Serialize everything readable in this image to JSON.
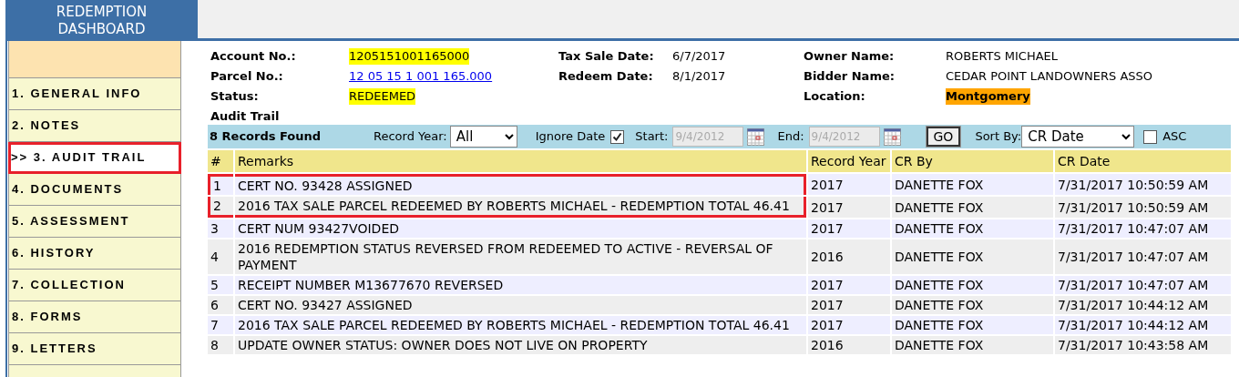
{
  "header": {
    "title": "REDEMPTION DASHBOARD"
  },
  "sidebar": {
    "items": [
      {
        "label": "1. GENERAL INFO",
        "selected": false,
        "highlighted": false
      },
      {
        "label": "2. NOTES",
        "selected": false,
        "highlighted": false
      },
      {
        "label": ">> 3. AUDIT TRAIL",
        "selected": true,
        "highlighted": true
      },
      {
        "label": "4. DOCUMENTS",
        "selected": false,
        "highlighted": false
      },
      {
        "label": "5. ASSESSMENT",
        "selected": false,
        "highlighted": false
      },
      {
        "label": "6. HISTORY",
        "selected": false,
        "highlighted": false
      },
      {
        "label": "7. COLLECTION",
        "selected": false,
        "highlighted": false
      },
      {
        "label": "8. FORMS",
        "selected": false,
        "highlighted": false
      },
      {
        "label": "9. LETTERS",
        "selected": false,
        "highlighted": false
      }
    ]
  },
  "info": [
    {
      "label": "Account No.:",
      "value": "1205151001165000",
      "kind": "highlight"
    },
    {
      "label": "Tax Sale Date:",
      "value": "6/7/2017",
      "kind": "plain"
    },
    {
      "label": "Owner Name:",
      "value": "ROBERTS MICHAEL",
      "kind": "plain"
    },
    {
      "label": "Parcel No.:",
      "value": "12 05 15 1 001 165.000",
      "kind": "link"
    },
    {
      "label": "Redeem Date:",
      "value": "8/1/2017",
      "kind": "plain"
    },
    {
      "label": "Bidder Name:",
      "value": "CEDAR POINT LANDOWNERS ASSO",
      "kind": "plain"
    },
    {
      "label": "Status:",
      "value": "REDEEMED",
      "kind": "highlight"
    },
    {
      "kind": "empty"
    },
    {
      "label": "Location:",
      "value": "Montgomery",
      "kind": "location"
    }
  ],
  "section_title": "Audit Trail",
  "toolbar": {
    "records_found": "8 Records Found",
    "record_year": {
      "label": "Record Year:",
      "value": "All"
    },
    "ignore_date": {
      "label": "Ignore Date",
      "checked": true
    },
    "start": {
      "label": "Start:",
      "value": "9/4/2012",
      "disabled": true
    },
    "end": {
      "label": "End:",
      "value": "9/4/2012",
      "disabled": true
    },
    "go": "GO",
    "sort_by": {
      "label": "Sort By:",
      "value": "CR Date"
    },
    "asc": {
      "label": "ASC",
      "checked": false
    }
  },
  "table": {
    "columns": [
      "#",
      "Remarks",
      "Record Year",
      "CR By",
      "CR Date"
    ],
    "rows": [
      {
        "cells": [
          "1",
          "CERT NO. 93428 ASSIGNED",
          "2017",
          "DANETTE FOX",
          "7/31/2017 10:50:59 AM"
        ],
        "highlighted": true
      },
      {
        "cells": [
          "2",
          "2016 TAX SALE PARCEL REDEEMED BY ROBERTS MICHAEL - REDEMPTION TOTAL 46.41",
          "2017",
          "DANETTE FOX",
          "7/31/2017 10:50:59 AM"
        ],
        "highlighted": true
      },
      {
        "cells": [
          "3",
          "CERT NUM 93427VOIDED",
          "2017",
          "DANETTE FOX",
          "7/31/2017 10:47:07 AM"
        ],
        "highlighted": false
      },
      {
        "cells": [
          "4",
          "2016 REDEMPTION STATUS REVERSED FROM REDEEMED TO ACTIVE - REVERSAL OF PAYMENT",
          "2016",
          "DANETTE FOX",
          "7/31/2017 10:47:07 AM"
        ],
        "highlighted": false
      },
      {
        "cells": [
          "5",
          "RECEIPT NUMBER M13677670 REVERSED",
          "2017",
          "DANETTE FOX",
          "7/31/2017 10:47:07 AM"
        ],
        "highlighted": false
      },
      {
        "cells": [
          "6",
          "CERT NO. 93427 ASSIGNED",
          "2017",
          "DANETTE FOX",
          "7/31/2017 10:44:12 AM"
        ],
        "highlighted": false
      },
      {
        "cells": [
          "7",
          "2016 TAX SALE PARCEL REDEEMED BY ROBERTS MICHAEL - REDEMPTION TOTAL 46.41",
          "2017",
          "DANETTE FOX",
          "7/31/2017 10:44:12 AM"
        ],
        "highlighted": false
      },
      {
        "cells": [
          "8",
          "UPDATE OWNER STATUS: OWNER DOES NOT LIVE ON PROPERTY",
          "2016",
          "DANETTE FOX",
          "7/31/2017 10:43:58 AM"
        ],
        "highlighted": false
      }
    ]
  }
}
